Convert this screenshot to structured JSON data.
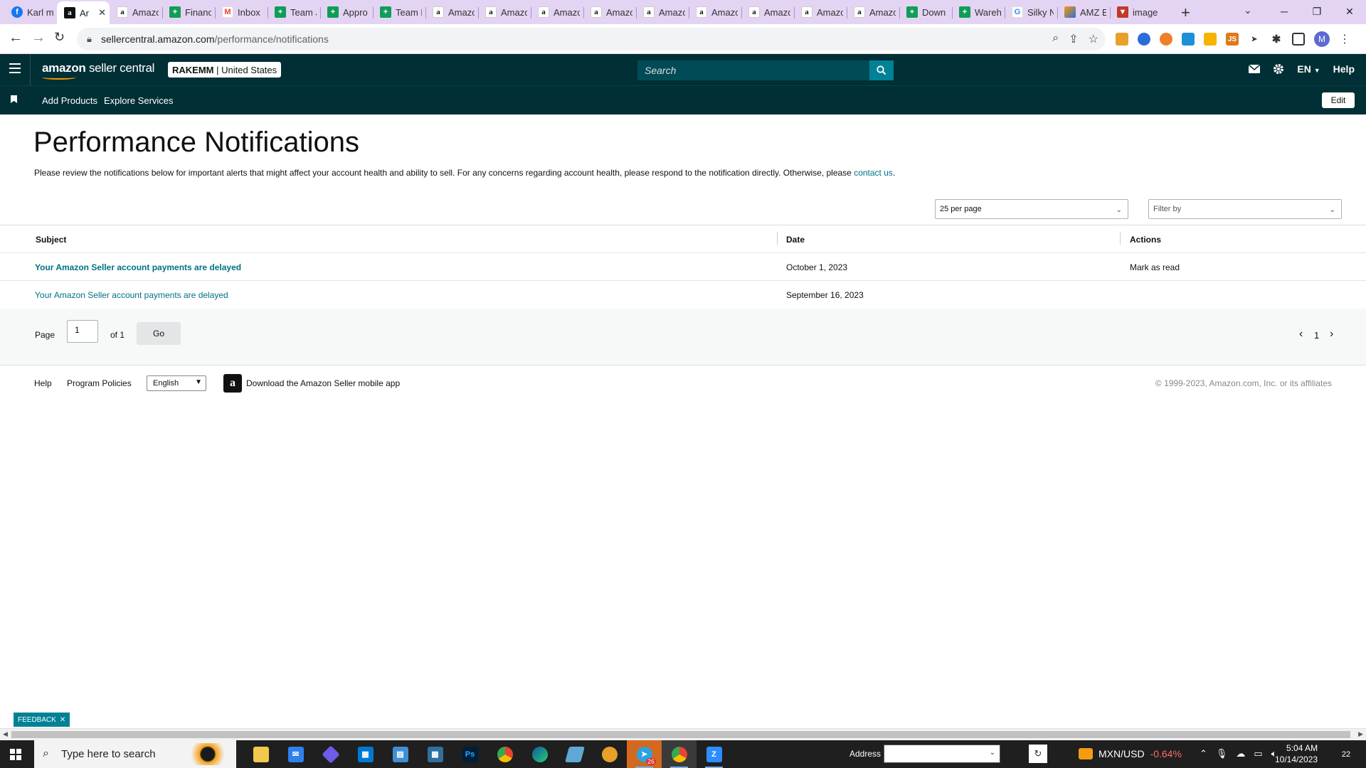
{
  "browser": {
    "tabs": [
      {
        "title": "Karl m",
        "icon": "facebook-icon",
        "active": false
      },
      {
        "title": "Ar",
        "icon": "amazon-icon",
        "active": true
      },
      {
        "title": "Amazo",
        "icon": "amazon-icon",
        "active": false
      },
      {
        "title": "Financ",
        "icon": "sheets-icon",
        "active": false
      },
      {
        "title": "Inbox",
        "icon": "gmail-icon",
        "active": false
      },
      {
        "title": "Team J",
        "icon": "sheets-icon",
        "active": false
      },
      {
        "title": "Appro",
        "icon": "sheets-icon",
        "active": false
      },
      {
        "title": "Team F",
        "icon": "sheets-icon",
        "active": false
      },
      {
        "title": "Amazo",
        "icon": "amazon-icon",
        "active": false
      },
      {
        "title": "Amazo",
        "icon": "amazon-icon",
        "active": false
      },
      {
        "title": "Amazo",
        "icon": "amazon-icon",
        "active": false
      },
      {
        "title": "Amazo",
        "icon": "amazon-icon",
        "active": false
      },
      {
        "title": "Amazo",
        "icon": "amazon-icon",
        "active": false
      },
      {
        "title": "Amazo",
        "icon": "amazon-icon",
        "active": false
      },
      {
        "title": "Amazo",
        "icon": "amazon-icon",
        "active": false
      },
      {
        "title": "Amazo",
        "icon": "amazon-icon",
        "active": false
      },
      {
        "title": "Amazo",
        "icon": "amazon-icon",
        "active": false
      },
      {
        "title": "Down",
        "icon": "sheets-icon",
        "active": false
      },
      {
        "title": "Wareh",
        "icon": "sheets-icon",
        "active": false
      },
      {
        "title": "Silky N",
        "icon": "google-icon",
        "active": false
      },
      {
        "title": "AMZ E",
        "icon": "amz-extension-icon",
        "active": false
      },
      {
        "title": "image",
        "icon": "image-icon",
        "active": false
      }
    ],
    "url_host": "sellercentral.amazon.com",
    "url_path": "/performance/notifications",
    "profile_initial": "M"
  },
  "header": {
    "logo_brand": "amazon",
    "logo_product": "seller central",
    "store_name": "RAKEMM",
    "store_marketplace": "United States",
    "search_placeholder": "Search",
    "language": "EN",
    "help": "Help"
  },
  "subnav": {
    "links": [
      "Add Products",
      "Explore Services"
    ],
    "edit": "Edit"
  },
  "page": {
    "title": "Performance Notifications",
    "intro": "Please review the notifications below for important alerts that might affect your account health and ability to sell. For any concerns regarding account health, please respond to the notification directly. Otherwise, please ",
    "intro_link": "contact us",
    "intro_end": ".",
    "per_page": "25 per page",
    "filter_placeholder": "Filter by"
  },
  "table": {
    "columns": [
      "Subject",
      "Date",
      "Actions"
    ],
    "rows": [
      {
        "subject": "Your Amazon Seller account payments are delayed",
        "date": "October 1, 2023",
        "action": "Mark as read",
        "unread": true
      },
      {
        "subject": "Your Amazon Seller account payments are delayed",
        "date": "September 16, 2023",
        "action": "",
        "unread": false
      }
    ]
  },
  "pager": {
    "page_label": "Page",
    "page_value": "1",
    "of_label": "of 1",
    "go": "Go",
    "current": "1"
  },
  "footer": {
    "help": "Help",
    "policies": "Program Policies",
    "language": "English",
    "app_text": "Download the Amazon Seller mobile app",
    "copyright": "© 1999-2023, Amazon.com, Inc. or its affiliates"
  },
  "feedback": "FEEDBACK",
  "taskbar": {
    "search_placeholder": "Type here to search",
    "address_label": "Address",
    "ticker_symbol": "MXN/USD",
    "ticker_change": "-0.64%",
    "time": "5:04 AM",
    "date": "10/14/2023",
    "notification_count": "22",
    "chrome_badge": "26"
  },
  "colors": {
    "header_bg": "#002f36",
    "search_button": "#008296",
    "link": "#007185",
    "tab_strip": "#e4d4f4"
  }
}
